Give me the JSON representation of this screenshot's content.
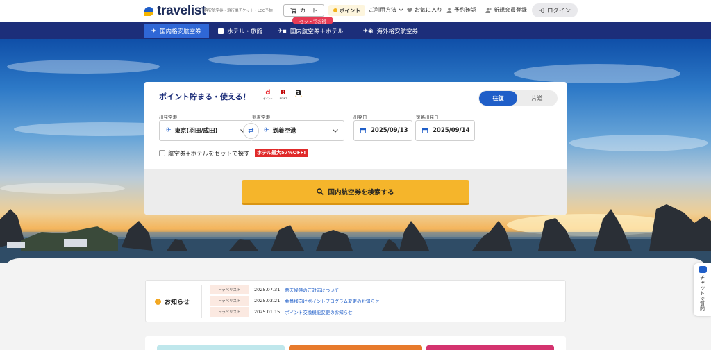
{
  "header": {
    "logo_text": "travelist",
    "tagline": "格安航空券・飛行機チケット・LCC予約",
    "cart_label": "カート",
    "point_label": "ポイント",
    "nav": [
      {
        "label": "ご利用方法",
        "icon": "chevron-down-icon"
      },
      {
        "label": "お気に入り",
        "icon": "heart-icon"
      },
      {
        "label": "予約確認",
        "icon": "user-icon"
      },
      {
        "label": "新規会員登録",
        "icon": "user-add-icon"
      }
    ],
    "login_label": "ログイン"
  },
  "navbar": {
    "tabs": [
      {
        "label": "国内格安航空券",
        "icon": "plane-icon",
        "active": true
      },
      {
        "label": "ホテル・旅館",
        "icon": "hotel-icon",
        "active": false
      },
      {
        "label": "国内航空券＋ホテル",
        "icon": "plane-hotel-icon",
        "active": false
      },
      {
        "label": "海外格安航空券",
        "icon": "globe-plane-icon",
        "active": false
      }
    ],
    "set_badge": "セットでお得"
  },
  "search": {
    "promo": "ポイント貯まる・使える！",
    "point_logos": [
      {
        "name": "d-point-icon",
        "mark": "d",
        "sub": "ポイント",
        "color": "#e8232a"
      },
      {
        "name": "r-point-icon",
        "mark": "R",
        "sub": "POINT",
        "color": "#bf0000"
      },
      {
        "name": "amazon-icon",
        "mark": "a",
        "sub": "",
        "color": "#222222"
      }
    ],
    "trip_round": "往復",
    "trip_oneway": "片道",
    "from_label": "出発空港",
    "from_value": "東京(羽田/成田)",
    "to_label": "到着空港",
    "to_value": "到着空港",
    "depart_label": "出発日",
    "depart_value": "2025/09/13",
    "return_label": "復路出発日",
    "return_value": "2025/09/14",
    "set_checkbox_label": "航空券+ホテルをセットで探す",
    "hotel_badge": "ホテル最大57%OFF!",
    "search_button": "国内航空券を検索する"
  },
  "news": {
    "title": "お知らせ",
    "items": [
      {
        "tag": "トラベリスト",
        "date": "2025.07.31",
        "text": "悪天候時のご対応について"
      },
      {
        "tag": "トラベリスト",
        "date": "2025.03.21",
        "text": "会員様向けポイントプログラム変更のお知らせ"
      },
      {
        "tag": "トラベリスト",
        "date": "2025.01.15",
        "text": "ポイント交換機能変更のお知らせ"
      }
    ]
  },
  "chat": {
    "label": "チャットで質問"
  },
  "colors": {
    "brand_navy": "#1c2e7a",
    "brand_blue": "#1f5ec8",
    "search_button": "#f5b52b",
    "badge_red": "#e02a2a"
  }
}
